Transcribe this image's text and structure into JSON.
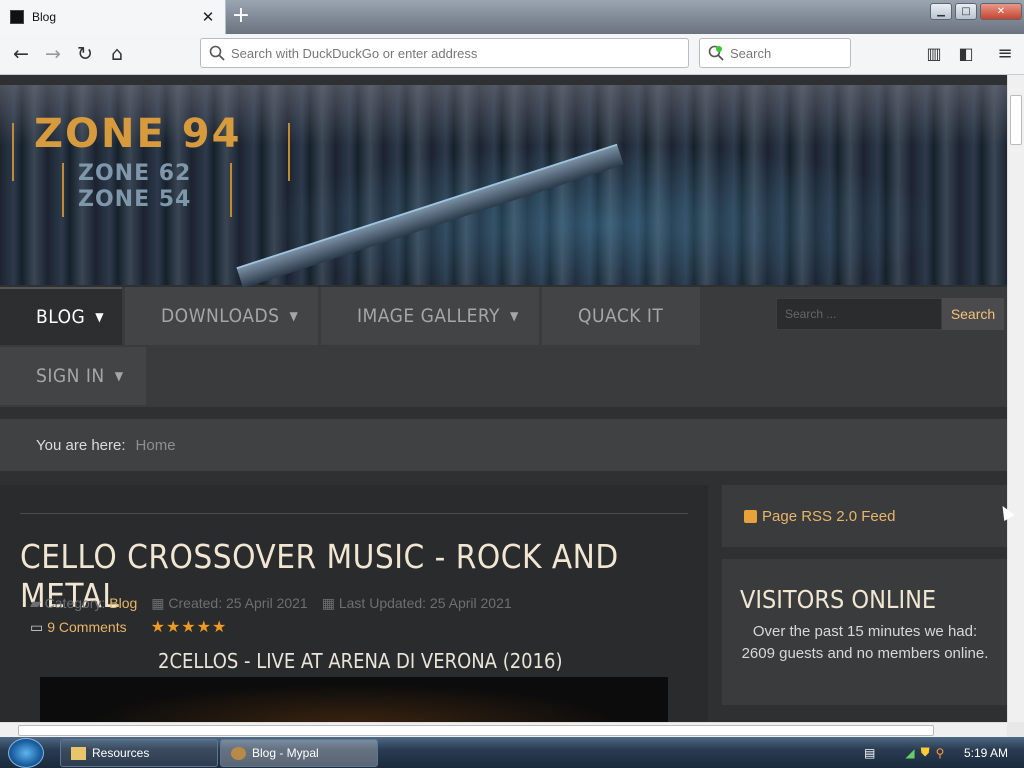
{
  "browser": {
    "tab_title": "Blog",
    "url_placeholder": "Search with DuckDuckGo or enter address",
    "search_placeholder": "Search"
  },
  "site": {
    "logo_main": "ZONE 94",
    "logo_line2": "ZONE 62",
    "logo_line3": "ZONE 54",
    "nav": [
      {
        "label": "BLOG",
        "active": true,
        "has_dropdown": true
      },
      {
        "label": "DOWNLOADS",
        "active": false,
        "has_dropdown": true
      },
      {
        "label": "IMAGE GALLERY",
        "active": false,
        "has_dropdown": true
      },
      {
        "label": "QUACK IT",
        "active": false,
        "has_dropdown": false
      },
      {
        "label": "SIGN IN",
        "active": false,
        "has_dropdown": true
      }
    ],
    "search_placeholder": "Search ...",
    "search_button": "Search",
    "breadcrumb_prefix": "You are here:",
    "breadcrumb_home": "Home"
  },
  "article": {
    "title": "CELLO CROSSOVER MUSIC - ROCK AND METAL",
    "category_label": "Category:",
    "category_value": "Blog",
    "created": "Created: 25 April 2021",
    "updated": "Last Updated: 25 April 2021",
    "comments": "9 Comments",
    "rating_stars": 5,
    "video_title": "2CELLOS - LIVE AT ARENA DI VERONA (2016)"
  },
  "sidebar": {
    "rss_label": "Page RSS 2.0 Feed",
    "visitors_title": "VISITORS ONLINE",
    "visitors_text": "Over the past 15 minutes we had: 2609 guests and no members online."
  },
  "taskbar": {
    "items": [
      "Resources",
      "Blog - Mypal"
    ],
    "clock": "5:19 AM"
  },
  "colors": {
    "accent": "#e8b56a",
    "stars": "#f09a26",
    "page_bg": "#2f3032"
  }
}
